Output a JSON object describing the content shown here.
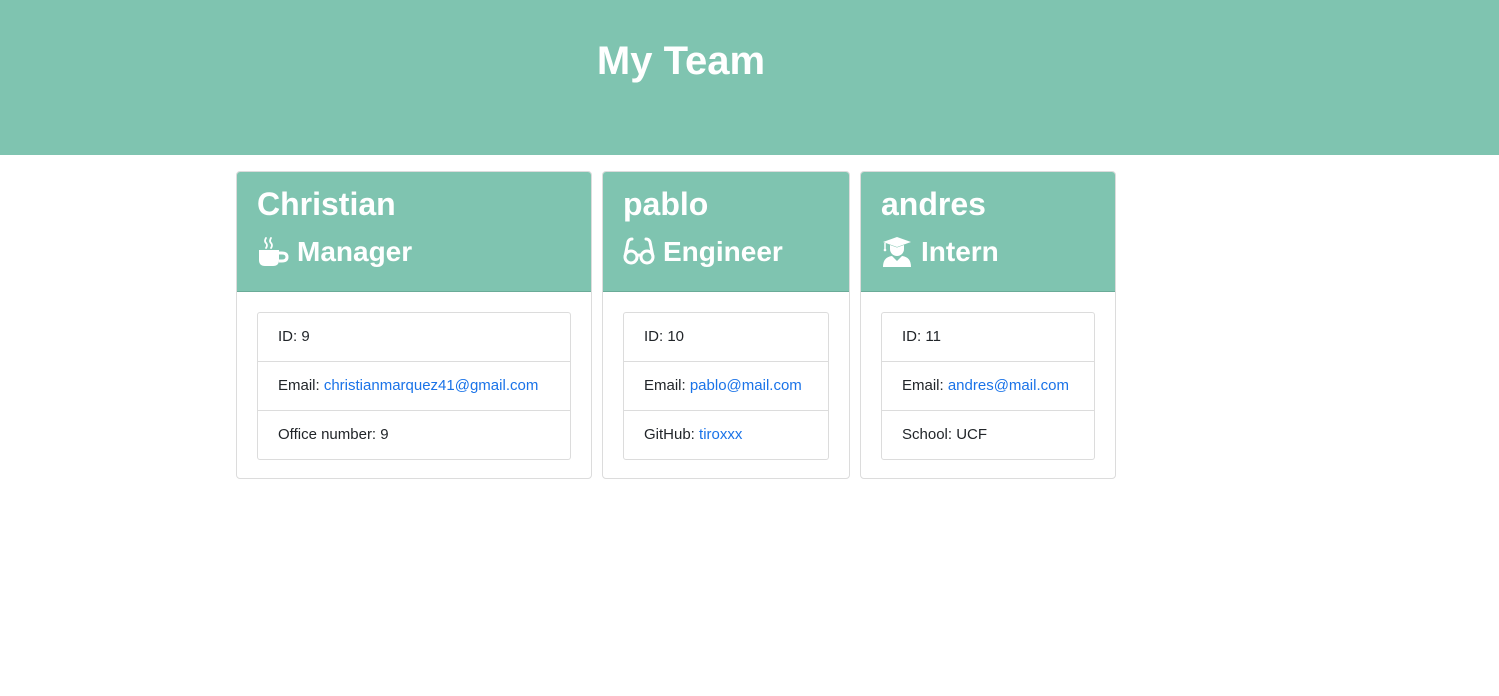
{
  "header": {
    "title": "My Team"
  },
  "team": [
    {
      "name": "Christian",
      "role": "Manager",
      "icon": "mug-icon",
      "id_label": "ID: 9",
      "email_prefix": "Email: ",
      "email": "christianmarquez41@gmail.com",
      "extra_prefix": "Office number: 9",
      "extra_value": ""
    },
    {
      "name": "pablo",
      "role": "Engineer",
      "icon": "glasses-icon",
      "id_label": "ID: 10",
      "email_prefix": "Email: ",
      "email": "pablo@mail.com",
      "extra_prefix": "GitHub: ",
      "extra_value": "tiroxxx"
    },
    {
      "name": "andres",
      "role": "Intern",
      "icon": "graduate-icon",
      "id_label": "ID: 11",
      "email_prefix": "Email: ",
      "email": "andres@mail.com",
      "extra_prefix": "School: UCF",
      "extra_value": ""
    }
  ],
  "colors": {
    "accent": "#7fc4b0",
    "link": "#1a73e8"
  }
}
